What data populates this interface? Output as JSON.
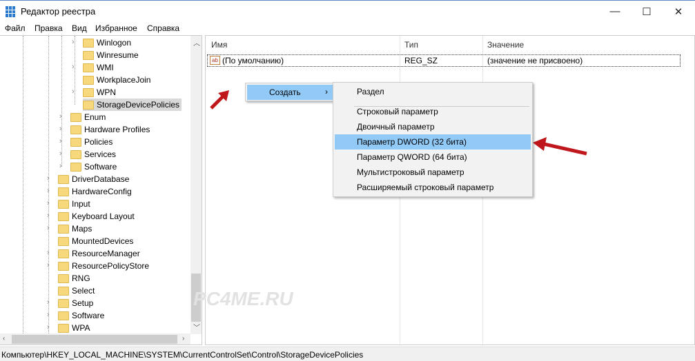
{
  "window": {
    "title": "Редактор реестра",
    "minimize": "—",
    "maximize": "☐",
    "close": "✕"
  },
  "menu": [
    "Файл",
    "Правка",
    "Вид",
    "Избранное",
    "Справка"
  ],
  "tree": [
    {
      "label": "Winlogon",
      "level": 3,
      "expandable": true
    },
    {
      "label": "Winresume",
      "level": 3,
      "expandable": false
    },
    {
      "label": "WMI",
      "level": 3,
      "expandable": true
    },
    {
      "label": "WorkplaceJoin",
      "level": 3,
      "expandable": false
    },
    {
      "label": "WPN",
      "level": 3,
      "expandable": true
    },
    {
      "label": "StorageDevicePolicies",
      "level": 3,
      "expandable": false,
      "selected": true
    },
    {
      "label": "Enum",
      "level": 2,
      "expandable": true
    },
    {
      "label": "Hardware Profiles",
      "level": 2,
      "expandable": true
    },
    {
      "label": "Policies",
      "level": 2,
      "expandable": true
    },
    {
      "label": "Services",
      "level": 2,
      "expandable": true
    },
    {
      "label": "Software",
      "level": 2,
      "expandable": true
    },
    {
      "label": "DriverDatabase",
      "level": 1,
      "expandable": true
    },
    {
      "label": "HardwareConfig",
      "level": 1,
      "expandable": true
    },
    {
      "label": "Input",
      "level": 1,
      "expandable": true
    },
    {
      "label": "Keyboard Layout",
      "level": 1,
      "expandable": true
    },
    {
      "label": "Maps",
      "level": 1,
      "expandable": true
    },
    {
      "label": "MountedDevices",
      "level": 1,
      "expandable": false
    },
    {
      "label": "ResourceManager",
      "level": 1,
      "expandable": true
    },
    {
      "label": "ResourcePolicyStore",
      "level": 1,
      "expandable": true
    },
    {
      "label": "RNG",
      "level": 1,
      "expandable": false
    },
    {
      "label": "Select",
      "level": 1,
      "expandable": false
    },
    {
      "label": "Setup",
      "level": 1,
      "expandable": true
    },
    {
      "label": "Software",
      "level": 1,
      "expandable": true
    },
    {
      "label": "WPA",
      "level": 1,
      "expandable": true
    }
  ],
  "list": {
    "columns": [
      "Имя",
      "Тип",
      "Значение"
    ],
    "rows": [
      {
        "name": "(По умолчанию)",
        "type": "REG_SZ",
        "value": "(значение не присвоено)",
        "icon": "ab"
      }
    ]
  },
  "context_menu": {
    "create": "Создать",
    "arrow": "›"
  },
  "submenu": [
    "Раздел",
    "Строковый параметр",
    "Двоичный параметр",
    "Параметр DWORD (32 бита)",
    "Параметр QWORD (64 бита)",
    "Мультистроковый параметр",
    "Расширяемый строковый параметр"
  ],
  "submenu_highlighted": 3,
  "status": "Компьютер\\HKEY_LOCAL_MACHINE\\SYSTEM\\CurrentControlSet\\Control\\StorageDevicePolicies",
  "watermark": "PC4ME.RU",
  "colors": {
    "highlight": "#91c9f7",
    "annotation_arrow": "#c0171c"
  }
}
